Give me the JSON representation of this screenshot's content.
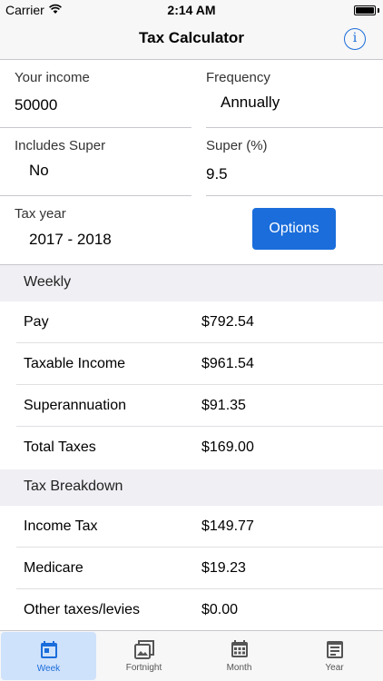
{
  "status_bar": {
    "carrier": "Carrier",
    "time": "2:14 AM"
  },
  "nav": {
    "title": "Tax Calculator",
    "info_icon": "i"
  },
  "form": {
    "income": {
      "label": "Your income",
      "value": "50000"
    },
    "frequency": {
      "label": "Frequency",
      "value": "Annually"
    },
    "includes_super": {
      "label": "Includes Super",
      "value": "No"
    },
    "super_percent": {
      "label": "Super (%)",
      "value": "9.5"
    },
    "tax_year": {
      "label": "Tax year",
      "value": "2017 - 2018"
    },
    "options_label": "Options"
  },
  "results": {
    "weekly_header": "Weekly",
    "weekly_rows": [
      {
        "label": "Pay",
        "value": "$792.54"
      },
      {
        "label": "Taxable Income",
        "value": "$961.54"
      },
      {
        "label": "Superannuation",
        "value": "$91.35"
      },
      {
        "label": "Total Taxes",
        "value": "$169.00"
      }
    ],
    "breakdown_header": "Tax Breakdown",
    "breakdown_rows": [
      {
        "label": "Income Tax",
        "value": "$149.77"
      },
      {
        "label": "Medicare",
        "value": "$19.23"
      },
      {
        "label": "Other taxes/levies",
        "value": "$0.00"
      }
    ]
  },
  "tabs": [
    {
      "label": "Week",
      "icon": "calendar-day-icon",
      "active": true
    },
    {
      "label": "Fortnight",
      "icon": "calendar-stack-icon",
      "active": false
    },
    {
      "label": "Month",
      "icon": "calendar-month-icon",
      "active": false
    },
    {
      "label": "Year",
      "icon": "calendar-year-icon",
      "active": false
    }
  ],
  "colors": {
    "accent": "#1a6ddb",
    "active_tab_bg": "#cfe2fb",
    "section_bg": "#efeff4"
  }
}
